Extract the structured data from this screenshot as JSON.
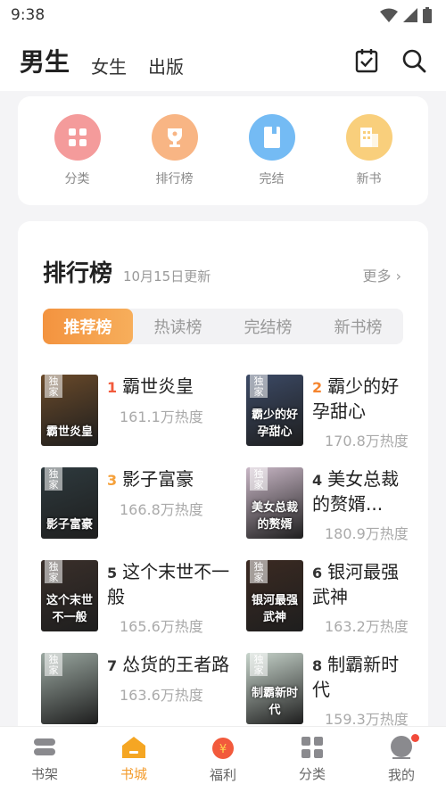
{
  "status": {
    "time": "9:38"
  },
  "top_tabs": [
    {
      "label": "男生",
      "active": true
    },
    {
      "label": "女生",
      "active": false
    },
    {
      "label": "出版",
      "active": false
    }
  ],
  "quick_entries": [
    {
      "label": "分类",
      "icon": "grid-icon",
      "color": "#f0797a"
    },
    {
      "label": "排行榜",
      "icon": "trophy-icon",
      "color": "#f6a066"
    },
    {
      "label": "完结",
      "icon": "book-icon",
      "color": "#4ea6ef"
    },
    {
      "label": "新书",
      "icon": "building-icon",
      "color": "#f7c35b"
    }
  ],
  "ranking": {
    "title": "排行榜",
    "update": "10月15日更新",
    "more": "更多",
    "tabs": [
      "推荐榜",
      "热读榜",
      "完结榜",
      "新书榜"
    ],
    "active_tab": 0,
    "books": [
      {
        "rank": "1",
        "name": "霸世炎皇",
        "heat": "161.1万热度",
        "tag": "独家",
        "cover_text": "霸世炎皇",
        "cover_color": "#6a4a2a",
        "rank_color": "#f25a3c"
      },
      {
        "rank": "2",
        "name": "霸少的好孕甜心",
        "heat": "170.8万热度",
        "tag": "独家",
        "cover_text": "霸少的好孕甜心",
        "cover_color": "#3c4a66",
        "rank_color": "#f5852f"
      },
      {
        "rank": "3",
        "name": "影子富豪",
        "heat": "166.8万热度",
        "tag": "独家",
        "cover_text": "影子富豪",
        "cover_color": "#2e3a3e",
        "rank_color": "#f5a03a"
      },
      {
        "rank": "4",
        "name": "美女总裁的赘婿...",
        "heat": "180.9万热度",
        "tag": "独家",
        "cover_text": "美女总裁的赘婿",
        "cover_color": "#c9b7c6",
        "rank_color": "#333333"
      },
      {
        "rank": "5",
        "name": "这个末世不一般",
        "heat": "165.6万热度",
        "tag": "独家",
        "cover_text": "这个末世不一般",
        "cover_color": "#3a2f2a",
        "rank_color": "#333333"
      },
      {
        "rank": "6",
        "name": "银河最强武神",
        "heat": "163.2万热度",
        "tag": "独家",
        "cover_text": "银河最强武神",
        "cover_color": "#3b2a22",
        "rank_color": "#333333"
      },
      {
        "rank": "7",
        "name": "怂货的王者路",
        "heat": "163.6万热度",
        "tag": "独家",
        "cover_text": "",
        "cover_color": "#9aa7a0",
        "rank_color": "#333333"
      },
      {
        "rank": "8",
        "name": "制霸新时代",
        "heat": "159.3万热度",
        "tag": "独家",
        "cover_text": "制霸新时代",
        "cover_color": "#c8d5cc",
        "rank_color": "#333333"
      }
    ]
  },
  "bottom_nav": [
    {
      "label": "书架",
      "icon": "bookshelf-icon",
      "active": false
    },
    {
      "label": "书城",
      "icon": "store-icon",
      "active": true
    },
    {
      "label": "福利",
      "icon": "welfare-icon",
      "active": false
    },
    {
      "label": "分类",
      "icon": "category-icon",
      "active": false
    },
    {
      "label": "我的",
      "icon": "profile-icon",
      "active": false
    }
  ]
}
